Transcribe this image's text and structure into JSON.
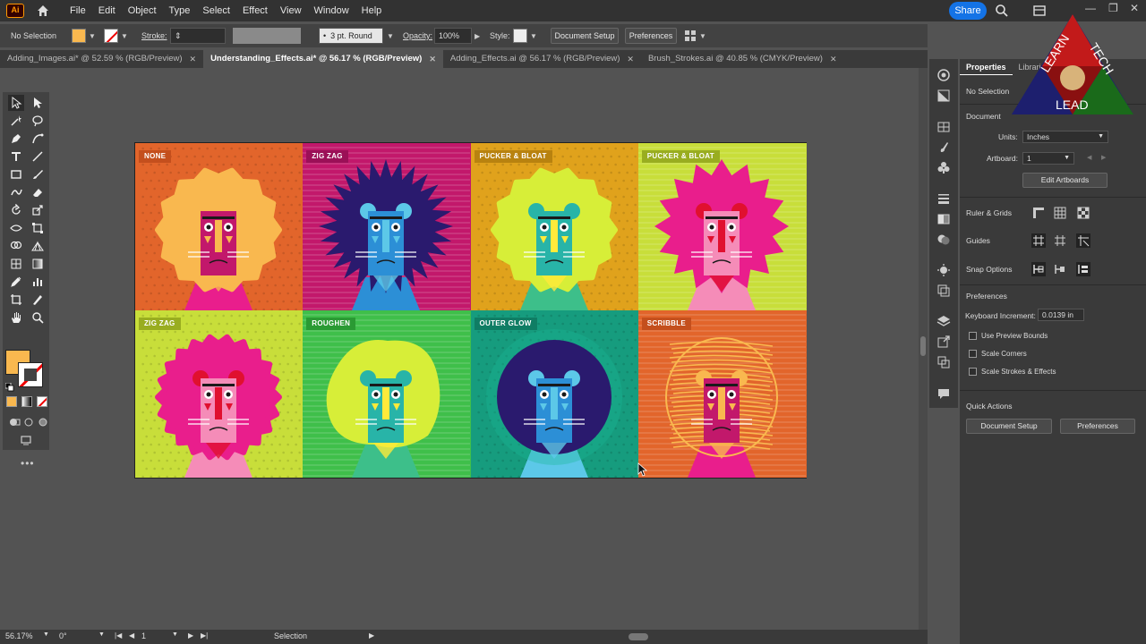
{
  "app": {
    "logo_text": "Ai"
  },
  "menu": [
    "File",
    "Edit",
    "Object",
    "Type",
    "Select",
    "Effect",
    "View",
    "Window",
    "Help"
  ],
  "header": {
    "share_label": "Share"
  },
  "control": {
    "selection_label": "No Selection",
    "stroke_label": "Stroke:",
    "brush_value": "3 pt. Round",
    "opacity_label": "Opacity:",
    "opacity_value": "100%",
    "style_label": "Style:",
    "doc_setup_label": "Document Setup",
    "preferences_label": "Preferences"
  },
  "tabs": [
    {
      "label": "Adding_Images.ai* @ 52.59 % (RGB/Preview)",
      "active": false
    },
    {
      "label": "Understanding_Effects.ai* @ 56.17 % (RGB/Preview)",
      "active": true
    },
    {
      "label": "Adding_Effects.ai @ 56.17 % (RGB/Preview)",
      "active": false
    },
    {
      "label": "Brush_Strokes.ai @ 40.85 % (CMYK/Preview)",
      "active": false
    }
  ],
  "artboard_cells": [
    {
      "label": "NONE",
      "bg": "#e2652b",
      "label_bg": "#c44f1d",
      "mane": "#f9b84f",
      "face": "#c2186b",
      "accent": "#f9b84f",
      "body": "#e91e8c"
    },
    {
      "label": "ZIG ZAG",
      "bg": "#c2186b",
      "label_bg": "#9b1057",
      "mane": "#2a1a6e",
      "face": "#2c8fd6",
      "accent": "#5cc8e8",
      "body": "#2c8fd6"
    },
    {
      "label": "PUCKER & BLOAT",
      "bg": "#e0a21c",
      "label_bg": "#b8820f",
      "mane": "#d7ee38",
      "face": "#28b4a8",
      "accent": "#ffea3a",
      "body": "#3dbf8a"
    },
    {
      "label": "PUCKER & BLOAT",
      "bg": "#c8de3a",
      "label_bg": "#99ad20",
      "mane": "#e91e8c",
      "face": "#f58cb8",
      "accent": "#e0102f",
      "body": "#f58cb8"
    },
    {
      "label": "ZIG ZAG",
      "bg": "#c8de3a",
      "label_bg": "#99ad20",
      "mane": "#e91e8c",
      "face": "#f58cb8",
      "accent": "#e0102f",
      "body": "#f58cb8"
    },
    {
      "label": "ROUGHEN",
      "bg": "#3fbf4a",
      "label_bg": "#2a9a33",
      "mane": "#d7ee38",
      "face": "#28b4a8",
      "accent": "#ffea3a",
      "body": "#3dbf8a"
    },
    {
      "label": "OUTER GLOW",
      "bg": "#169c7e",
      "label_bg": "#0f7d64",
      "mane": "#2a1a6e",
      "face": "#2c8fd6",
      "accent": "#5cc8e8",
      "body": "#5cc8e8"
    },
    {
      "label": "SCRIBBLE",
      "bg": "#e2652b",
      "label_bg": "#c44f1d",
      "mane": "#f9b84f",
      "face": "#c2186b",
      "accent": "#f9b84f",
      "body": "#e91e8c"
    }
  ],
  "status": {
    "zoom": "56.17%",
    "rotation": "0°",
    "artboard_num": "1",
    "tool_name": "Selection"
  },
  "properties": {
    "tabs": [
      "Properties",
      "Libraries"
    ],
    "selection_state": "No Selection",
    "document_title": "Document",
    "units_label": "Units:",
    "units_value": "Inches",
    "artboard_label": "Artboard:",
    "artboard_value": "1",
    "edit_artboards_label": "Edit Artboards",
    "ruler_grids_label": "Ruler & Grids",
    "guides_label": "Guides",
    "snap_options_label": "Snap Options",
    "preferences_title": "Preferences",
    "keyboard_increment_label": "Keyboard Increment:",
    "keyboard_increment_value": "0.0139 in",
    "checkboxes": [
      "Use Preview Bounds",
      "Scale Corners",
      "Scale Strokes & Effects"
    ],
    "quick_actions_title": "Quick Actions",
    "doc_setup_label": "Document Setup",
    "preferences_label": "Preferences"
  },
  "brand": {
    "word1": "LEARN",
    "word2": "TECH",
    "word3": "LEAD"
  },
  "colors": {
    "fill_swatch": "#f9b84f",
    "accent_blue": "#1473e6",
    "panel_bg": "#3a3a3a"
  }
}
